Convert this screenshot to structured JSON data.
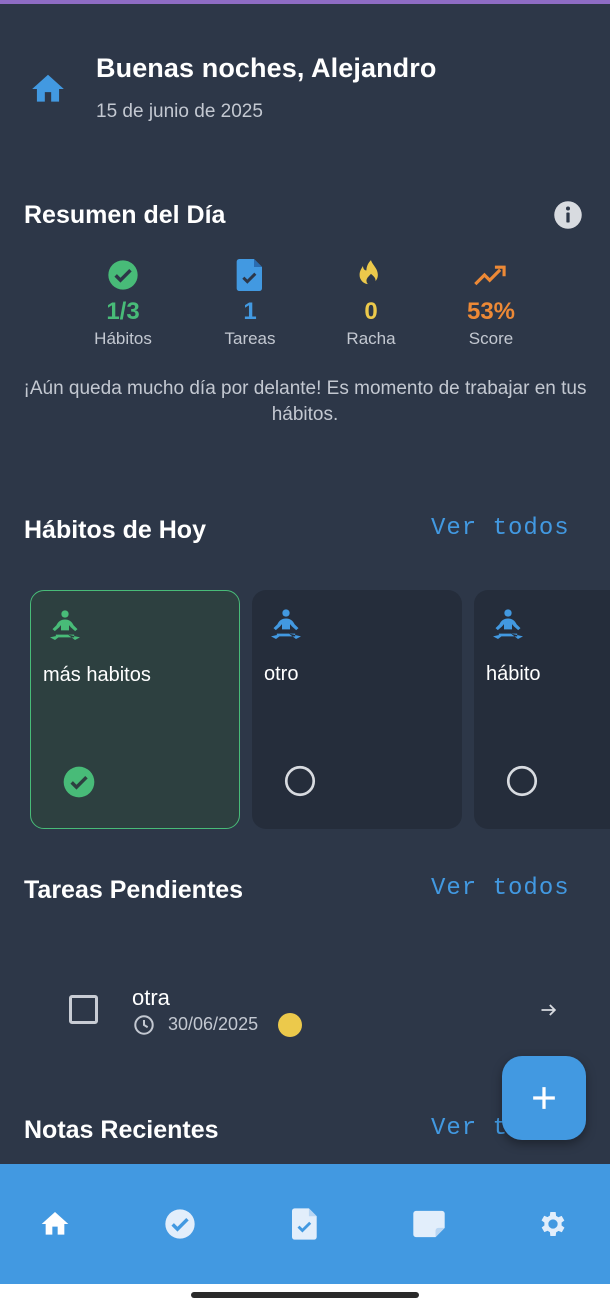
{
  "header": {
    "greeting": "Buenas noches, Alejandro",
    "date": "15 de junio de 2025"
  },
  "summary": {
    "title": "Resumen del Día",
    "stats": [
      {
        "value": "1/3",
        "label": "Hábitos",
        "icon": "check-circle-icon",
        "color": "#48bb78"
      },
      {
        "value": "1",
        "label": "Tareas",
        "icon": "task-document-icon",
        "color": "#4299e1"
      },
      {
        "value": "0",
        "label": "Racha",
        "icon": "fire-icon",
        "color": "#ecc94b"
      },
      {
        "value": "53%",
        "label": "Score",
        "icon": "trending-up-icon",
        "color": "#ed8936"
      }
    ],
    "message": "¡Aún queda mucho día por delante! Es momento de trabajar en tus hábitos."
  },
  "habits": {
    "title": "Hábitos de Hoy",
    "see_all": "Ver todos",
    "items": [
      {
        "name": "más habitos",
        "completed": true
      },
      {
        "name": "otro",
        "completed": false
      },
      {
        "name": "hábito",
        "completed": false
      }
    ]
  },
  "tasks": {
    "title": "Tareas Pendientes",
    "see_all": "Ver todos",
    "items": [
      {
        "title": "otra",
        "due_date": "30/06/2025",
        "priority_color": "#ecc94b"
      }
    ]
  },
  "notes": {
    "title": "Notas Recientes",
    "see_all": "Ver todos"
  },
  "nav": {
    "items": [
      "home-icon",
      "habits-check-icon",
      "tasks-icon",
      "notes-icon",
      "settings-icon"
    ]
  },
  "colors": {
    "background": "#2d3748",
    "accent": "#4299e1",
    "success": "#48bb78",
    "warning": "#ecc94b",
    "score": "#ed8936"
  }
}
